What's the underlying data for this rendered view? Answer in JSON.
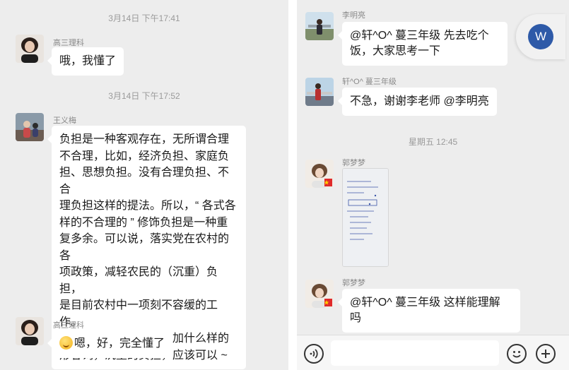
{
  "left_chat": {
    "ts1": "3月14日 下午17:41",
    "msg1": {
      "sender": "高三理科",
      "text": "哦，我懂了"
    },
    "ts2": "3月14日 下午17:52",
    "msg2": {
      "sender": "王义梅",
      "lines": [
        "负担是一种客观存在，无所谓合理",
        "不合理，比如，经济负担、家庭负",
        "担、思想负担。没有合理负担、不合",
        "理负担这样的提法。所以，“ 各式各",
        "样的不合理的 ” 修饰负担是一种重",
        "复多余。可以说，落实党在农村的各",
        "项政策，减轻农民的（沉重）负担，",
        "是目前农村中一项刻不容缓的工作。",
        "同学刚才问，负担前面加什么样的",
        "形容词，沉重的负担，应该可以 ~"
      ]
    },
    "msg3": {
      "sender": "高三理科",
      "text": "嗯，好，完全懂了"
    }
  },
  "right_chat": {
    "msg1": {
      "sender": "李明亮",
      "lines": [
        "@轩^O^ 蔓三年级 先去吃个",
        "饭，大家思考一下"
      ]
    },
    "msg2": {
      "sender": "轩^O^ 蔓三年级",
      "text": "不急，谢谢李老师 @李明亮"
    },
    "ts": "星期五 12:45",
    "msg3": {
      "sender": "郭梦梦"
    },
    "msg4": {
      "sender": "郭梦梦",
      "lines": [
        "@轩^O^ 蔓三年级 这样能理解",
        "吗"
      ]
    }
  },
  "floating_badge": {
    "letter": "W",
    "color": "#2e5aa8"
  },
  "icons": {
    "voice": "voice-icon",
    "emoji": "emoji-icon",
    "add": "add-icon"
  }
}
